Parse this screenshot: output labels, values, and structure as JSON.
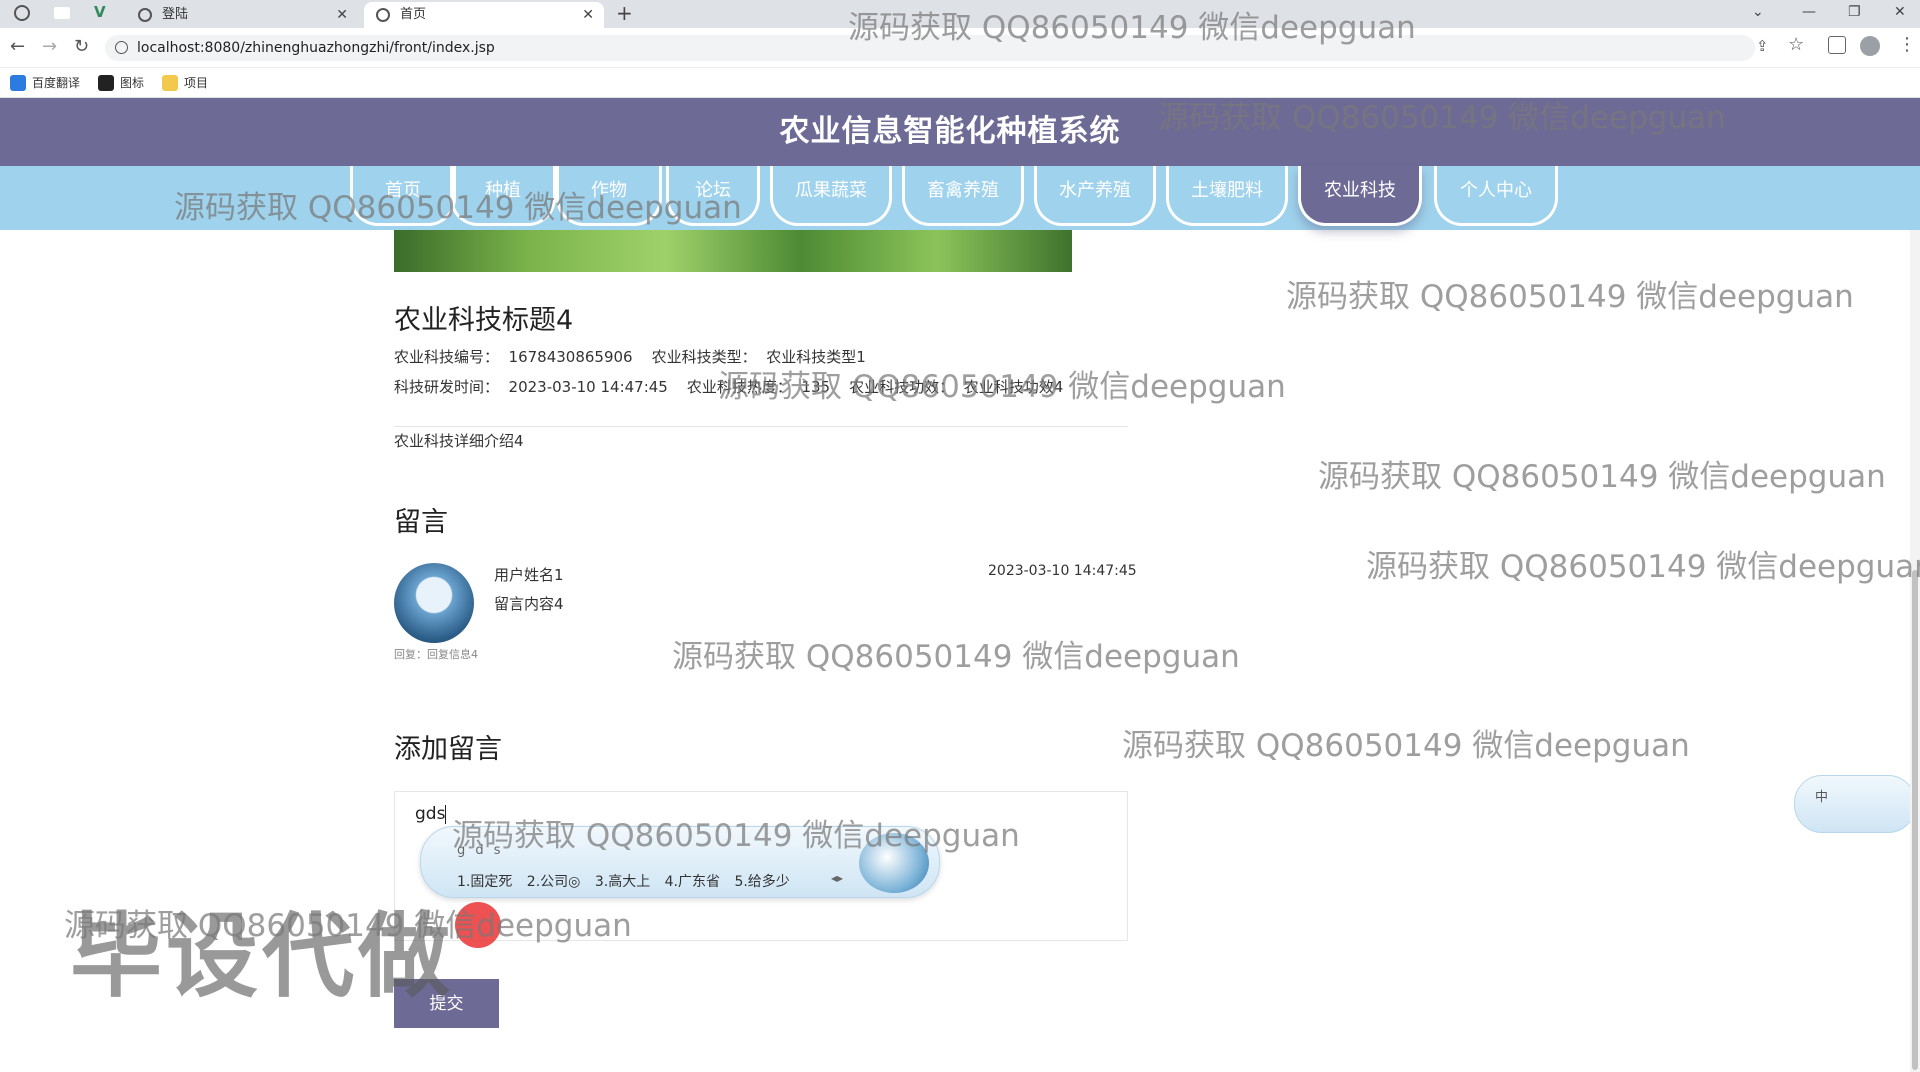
{
  "browser": {
    "tabs": [
      {
        "label": "登陆"
      },
      {
        "label": "首页"
      }
    ],
    "new_tab": "+",
    "url": "localhost:8080/zhinenghuazhongzhi/front/index.jsp",
    "bookmarks": [
      {
        "label": "百度翻译",
        "color": "#2b7be0"
      },
      {
        "label": "图标",
        "color": "#222222"
      },
      {
        "label": "项目",
        "color": "#f2c94c"
      }
    ]
  },
  "site": {
    "title": "农业信息智能化种植系统",
    "nav": [
      {
        "label": "首页"
      },
      {
        "label": "种植"
      },
      {
        "label": "作物"
      },
      {
        "label": "论坛"
      },
      {
        "label": "瓜果蔬菜"
      },
      {
        "label": "畜禽养殖"
      },
      {
        "label": "水产养殖"
      },
      {
        "label": "土壤肥料"
      },
      {
        "label": "农业科技",
        "active": true
      },
      {
        "label": "个人中心"
      }
    ],
    "accent": "#6d6a96",
    "nav_bg": "#9fd2ec"
  },
  "detail": {
    "title": "农业科技标题4",
    "line1": "农业科技编号：  1678430865906    农业科技类型：  农业科技类型1",
    "line2": "科技研发时间：  2023-03-10 14:47:45    农业科技热度：  135    农业科技功效：  农业科技功效4",
    "intro": "农业科技详细介绍4"
  },
  "comments": {
    "heading": "留言",
    "items": [
      {
        "user": "用户姓名1",
        "content": "留言内容4",
        "time": "2023-03-10 14:47:45",
        "reply": "回复：回复信息4"
      }
    ]
  },
  "add_comment": {
    "heading": "添加留言",
    "value": "gds",
    "submit": "提交"
  },
  "ime": {
    "pinyin": "g d s",
    "candidates": "1.固定死  2.公司◎  3.高大上  4.广东省  5.给多少",
    "side_label": "中"
  },
  "watermarks": {
    "text": "源码获取 QQ86050149 微信deepguan",
    "big": "毕设代做"
  }
}
